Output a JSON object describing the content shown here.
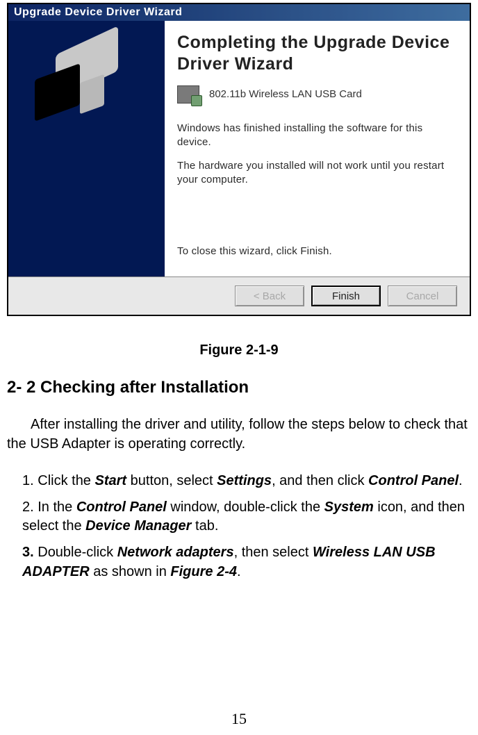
{
  "wizard": {
    "title": "Upgrade Device Driver Wizard",
    "heading": "Completing the Upgrade Device Driver Wizard",
    "device_name": "802.11b Wireless LAN USB Card",
    "text1": "Windows has finished installing the software for this device.",
    "text2": "The hardware you installed will not work until you restart your computer.",
    "close_hint": "To close this wizard, click Finish.",
    "buttons": {
      "back": "< Back",
      "finish": "Finish",
      "cancel": "Cancel"
    }
  },
  "doc": {
    "figure_caption": "Figure 2-1-9",
    "section_heading": "2- 2 Checking after Installation",
    "intro_para": "After installing the driver and utility, follow the steps below to check that the USB Adapter is operating correctly.",
    "steps": {
      "s1": {
        "num": "1.",
        "pre": " Click the ",
        "t1": "Start",
        "mid1": " button, select ",
        "t2": "Settings",
        "mid2": ", and then click ",
        "t3": "Control Panel",
        "post": "."
      },
      "s2": {
        "num": "2.",
        "pre": " In the ",
        "t1": "Control Panel",
        "mid1": " window, double-click the ",
        "t2": "System",
        "mid2": " icon, and then select the ",
        "t3": "Device Manager",
        "post": " tab."
      },
      "s3": {
        "num": "3.",
        "pre": " Double-click ",
        "t1": "Network adapters",
        "mid1": ", then select ",
        "t2": "Wireless LAN USB ADAPTER",
        "mid2": " as shown in ",
        "t3": "Figure 2-4",
        "post": "."
      }
    },
    "page_number": "15"
  }
}
